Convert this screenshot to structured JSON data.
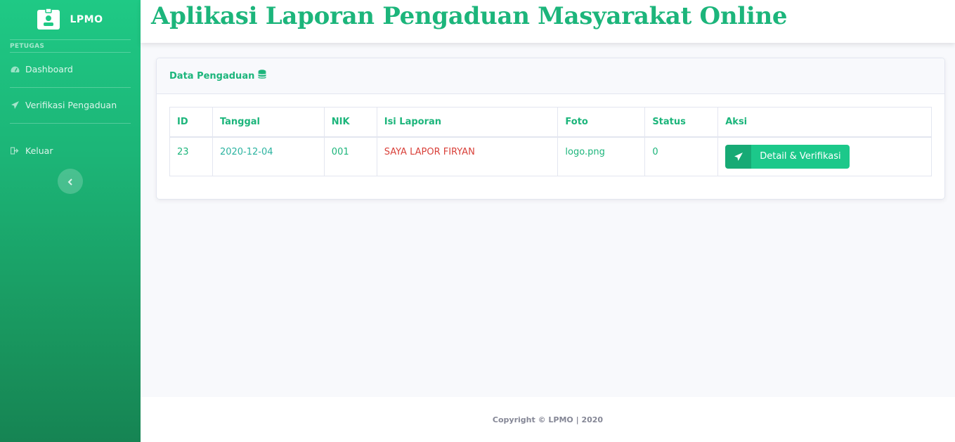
{
  "brand": {
    "name": "LPMO",
    "icon": "id-badge-icon"
  },
  "sidebar": {
    "heading": "PETUGAS",
    "items": [
      {
        "label": "Dashboard",
        "icon": "tachometer-icon"
      },
      {
        "label": "Verifikasi Pengaduan",
        "icon": "paper-plane-icon"
      },
      {
        "label": "Keluar",
        "icon": "sign-out-icon"
      }
    ],
    "toggle_icon": "chevron-left-icon"
  },
  "header": {
    "title": "Aplikasi Laporan Pengaduan Masyarakat Online"
  },
  "card": {
    "title": "Data Pengaduan",
    "title_icon": "database-icon",
    "table": {
      "columns": [
        "ID",
        "Tanggal",
        "NIK",
        "Isi Laporan",
        "Foto",
        "Status",
        "Aksi"
      ],
      "rows": [
        {
          "id": "23",
          "tanggal": "2020-12-04",
          "nik": "001",
          "isi_laporan": "SAYA LAPOR FIRYAN",
          "foto": "logo.png",
          "status": "0",
          "aksi_label": "Detail & Verifikasi",
          "aksi_icon": "paper-plane-icon"
        }
      ]
    }
  },
  "footer": {
    "text": "Copyright © LPMO | 2020"
  },
  "colors": {
    "accent": "#1cb57b",
    "sidebar_top": "#1fc985",
    "sidebar_bottom": "#168453",
    "danger": "#d9413a",
    "button": "#1cc88a"
  }
}
